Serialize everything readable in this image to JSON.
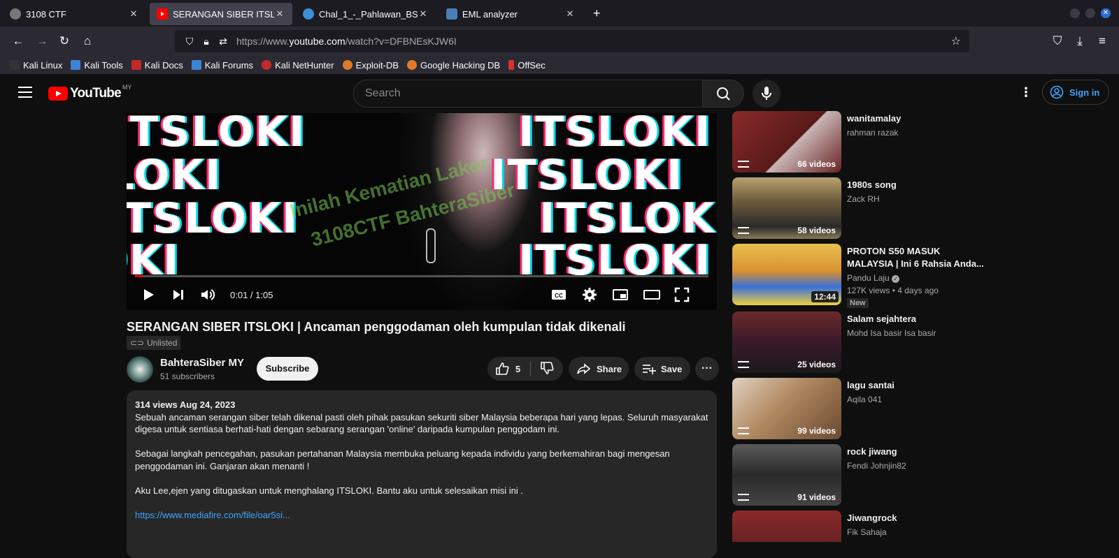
{
  "browser": {
    "tabs": [
      {
        "title": "3108 CTF"
      },
      {
        "title": "SERANGAN SIBER ITSLOKI"
      },
      {
        "title": "Chal_1_-_Pahlawan_BS"
      },
      {
        "title": "EML analyzer"
      }
    ],
    "url_prefix": "https://www.",
    "url_domain": "youtube.com",
    "url_path": "/watch?v=DFBNEsKJW6I",
    "bookmarks": [
      {
        "label": "Kali Linux",
        "color": "#3a84d6"
      },
      {
        "label": "Kali Tools",
        "color": "#d63a3a"
      },
      {
        "label": "Kali Docs",
        "color": "#c42a2a"
      },
      {
        "label": "Kali Forums",
        "color": "#3a84d6"
      },
      {
        "label": "Kali NetHunter",
        "color": "#c42a2a"
      },
      {
        "label": "Exploit-DB",
        "color": "#e07a2a"
      },
      {
        "label": "Google Hacking DB",
        "color": "#e07a2a"
      },
      {
        "label": "OffSec",
        "color": "#d6342a"
      }
    ]
  },
  "youtube": {
    "logo_text": "YouTube",
    "country": "MY",
    "search_placeholder": "Search",
    "signin": "Sign in"
  },
  "player": {
    "time": "0:01 / 1:05",
    "progress_fraction": 0.015,
    "glitch_text": "ITSLOKI",
    "overlay_text_1": "Inilah Kematian Lakor",
    "overlay_text_2": "3108CTF BahteraSiber"
  },
  "video": {
    "title": "SERANGAN SIBER ITSLOKI | Ancaman penggodaman oleh kumpulan tidak dikenali",
    "unlisted": "Unlisted",
    "channel": "BahteraSiber MY",
    "subscribers": "51 subscribers",
    "subscribe": "Subscribe",
    "likes": "5",
    "share": "Share",
    "save": "Save",
    "meta": "314 views  Aug 24, 2023",
    "desc1": "Sebuah ancaman serangan siber telah dikenal pasti oleh pihak pasukan sekuriti siber Malaysia beberapa hari yang lepas. Seluruh masyarakat digesa untuk sentiasa berhati-hati dengan sebarang serangan 'online' daripada kumpulan penggodam ini.",
    "desc2": "Sebagai langkah pencegahan, pasukan pertahanan Malaysia membuka peluang kepada individu yang berkemahiran bagi mengesan penggodaman ini. Ganjaran akan menanti !",
    "desc3": "Aku Lee,ejen yang ditugaskan untuk menghalang ITSLOKI. Bantu aku untuk selesaikan misi ini .",
    "link": "https://www.mediafire.com/file/oar5si..."
  },
  "sidebar": [
    {
      "title": "wanitamalay",
      "sub": "rahman razak",
      "badge": "66 videos",
      "color": "#6a2222"
    },
    {
      "title": "1980s song",
      "sub": "Zack RH",
      "badge": "58 videos",
      "color": "#8a7a55"
    },
    {
      "title": "PROTON S50 MASUK MALAYSIA | Ini 6 Rahsia Anda...",
      "sub": "Pandu Laju",
      "stats": "127K views  •  4 days ago",
      "new": "New",
      "duration": "12:44",
      "color": "#d8a040"
    },
    {
      "title": "Salam sejahtera",
      "sub": "Mohd Isa basir Isa basir",
      "badge": "25 videos",
      "color": "#4a1f2a"
    },
    {
      "title": "lagu santai",
      "sub": "Aqila 041",
      "badge": "99 videos",
      "color": "#8a6a48"
    },
    {
      "title": "rock jiwang",
      "sub": "Fendi Johnjin82",
      "badge": "91 videos",
      "color": "#3a3a3a"
    },
    {
      "title": "Jiwangrock",
      "sub": "Fik Sahaja",
      "color": "#6a2020"
    }
  ]
}
